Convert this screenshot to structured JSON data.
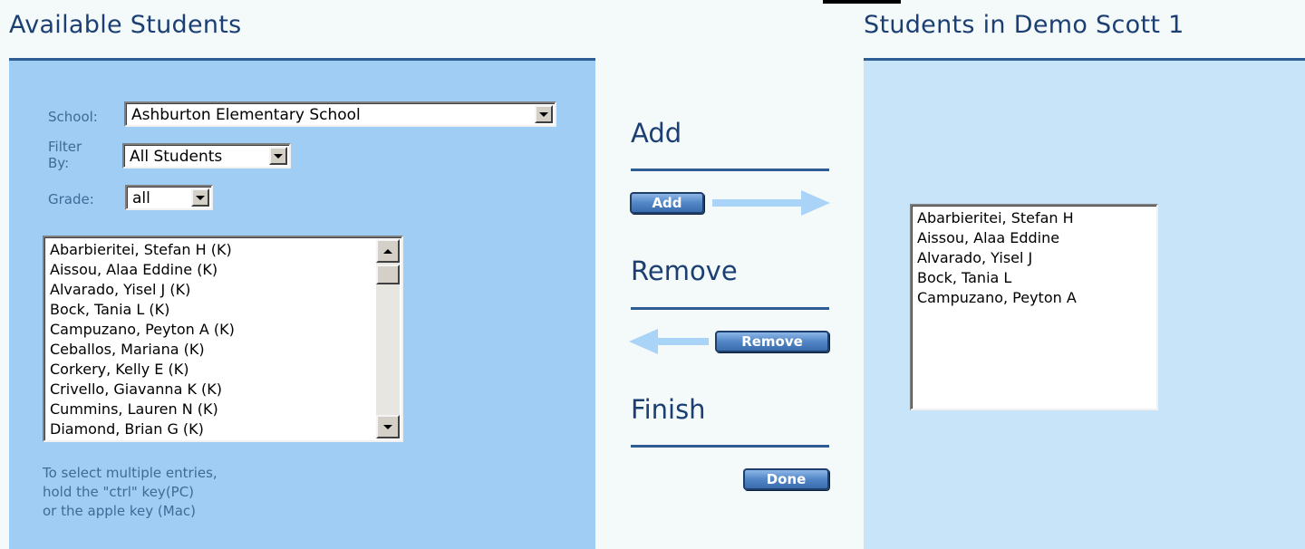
{
  "left": {
    "title": "Available Students",
    "school_label": "School:",
    "school_value": "Ashburton Elementary School",
    "filter_label_line1": "Filter",
    "filter_label_line2": "By:",
    "filter_value": "All Students",
    "grade_label": "Grade:",
    "grade_value": "all",
    "students": [
      "Abarbieritei, Stefan H (K)",
      "Aissou, Alaa Eddine (K)",
      "Alvarado, Yisel J (K)",
      "Bock, Tania L (K)",
      "Campuzano, Peyton A (K)",
      "Ceballos, Mariana (K)",
      "Corkery, Kelly E (K)",
      "Crivello, Giavanna K (K)",
      "Cummins, Lauren N (K)",
      "Diamond, Brian G (K)"
    ],
    "hint_lines": [
      "To select multiple entries,",
      "hold the \"ctrl\" key(PC)",
      "or the apple key (Mac)"
    ]
  },
  "middle": {
    "add_title": "Add",
    "add_button": "Add",
    "remove_title": "Remove",
    "remove_button": "Remove",
    "finish_title": "Finish",
    "done_button": "Done"
  },
  "right": {
    "title": "Students in Demo Scott 1",
    "students": [
      "Abarbieritei, Stefan H",
      "Aissou, Alaa Eddine",
      "Alvarado, Yisel J",
      "Bock, Tania L",
      "Campuzano, Peyton A"
    ]
  },
  "colors": {
    "left_panel": "#9fcdf4",
    "right_panel": "#c8e4f8",
    "heading": "#1b3f73",
    "arrow": "#a9d4f7"
  },
  "icons": {
    "dropdown": "chevron-down-icon",
    "scroll_up": "scroll-up-arrow-icon",
    "scroll_down": "scroll-down-arrow-icon",
    "add_arrow": "arrow-right-icon",
    "remove_arrow": "arrow-left-icon"
  }
}
